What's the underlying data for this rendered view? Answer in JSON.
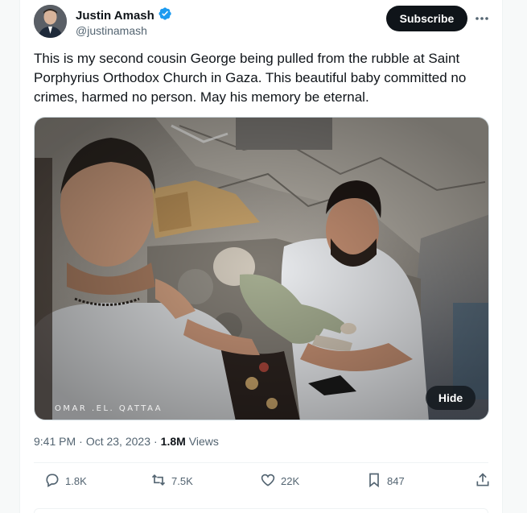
{
  "author": {
    "name": "Justin Amash",
    "handle": "@justinamash",
    "verified": true,
    "verified_color": "#1d9bf0"
  },
  "header": {
    "subscribe_label": "Subscribe",
    "more_icon": "more-dots-icon"
  },
  "tweet": {
    "text": "This is my second cousin George being pulled from the rubble at Saint Porphyrius Orthodox Church in Gaza. This beautiful baby committed no crimes, harmed no person. May his memory be eternal."
  },
  "media": {
    "watermark": "OMAR .EL. QATTAA",
    "hide_label": "Hide"
  },
  "meta": {
    "time": "9:41 PM",
    "separator": "·",
    "date": "Oct 23, 2023",
    "views_count": "1.8M",
    "views_label": "Views"
  },
  "actions": {
    "reply_count": "1.8K",
    "retweet_count": "7.5K",
    "like_count": "22K",
    "bookmark_count": "847"
  },
  "colors": {
    "text_primary": "#0f1419",
    "text_secondary": "#536471",
    "subscribe_bg": "#0f1419"
  }
}
